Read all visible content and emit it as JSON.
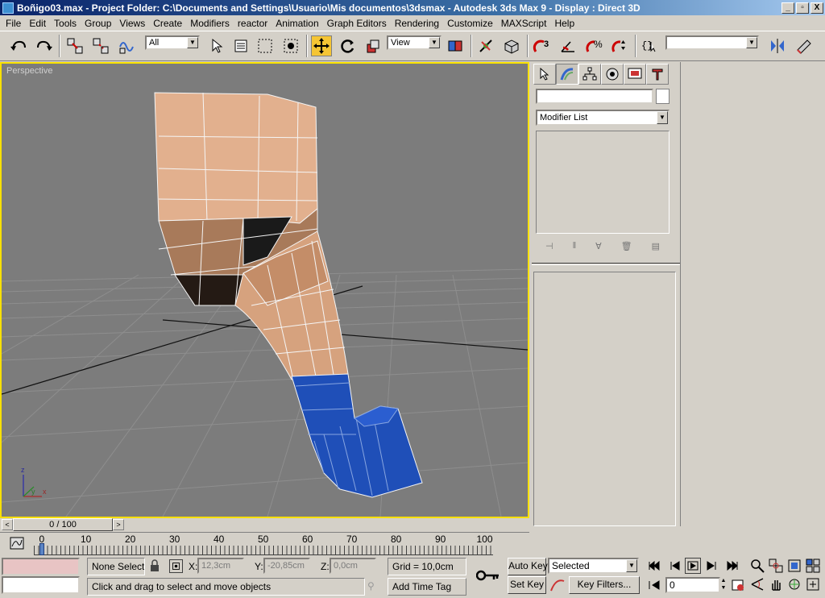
{
  "window": {
    "title": "Boñigo03.max    - Project Folder: C:\\Documents and Settings\\Usuario\\Mis documentos\\3dsmax    - Autodesk 3ds Max 9     - Display : Direct 3D",
    "minimize": "_",
    "maximize": "▫",
    "close": "X"
  },
  "menu": [
    "File",
    "Edit",
    "Tools",
    "Group",
    "Views",
    "Create",
    "Modifiers",
    "reactor",
    "Animation",
    "Graph Editors",
    "Rendering",
    "Customize",
    "MAXScript",
    "Help"
  ],
  "toolbar": {
    "selection_filter": "All",
    "reference_coord": "View",
    "named_selection": "",
    "icons": [
      "undo-icon",
      "redo-icon",
      "select-and-link-icon",
      "unlink-selection-icon",
      "bind-to-space-warp-icon",
      "select-object-icon",
      "select-by-name-icon",
      "rectangular-selection-region-icon",
      "window-crossing-icon",
      "select-and-move-icon",
      "select-and-rotate-icon",
      "select-and-uniform-scale-icon",
      "use-pivot-center-icon",
      "select-and-manipulate-icon",
      "keyboard-shortcut-override-icon",
      "snaps-toggle-icon",
      "angle-snap-icon",
      "percent-snap-icon",
      "spinner-snap-icon",
      "edit-named-selection-icon",
      "mirror-icon",
      "align-icon"
    ]
  },
  "viewport": {
    "label": "Perspective",
    "colors": {
      "background": "#7c7c7c",
      "border_active": "#f8e000",
      "skin": "#e8b08a",
      "shoe": "#1f4fb8"
    },
    "axis": {
      "x": "x",
      "y": "y",
      "z": "z"
    }
  },
  "command_panel": {
    "tabs": [
      "create-tab",
      "modify-tab",
      "hierarchy-tab",
      "motion-tab",
      "display-tab",
      "utilities-tab"
    ],
    "object_name": "",
    "modifier_list": "Modifier List"
  },
  "time_slider": {
    "position": "0 / 100",
    "prev": "<",
    "next": ">",
    "current_frame": 0,
    "total_frames": 100
  },
  "trackbar": {
    "ticks": [
      "0",
      "10",
      "20",
      "30",
      "40",
      "50",
      "60",
      "70",
      "80",
      "90",
      "100"
    ]
  },
  "status": {
    "selection": "None Selecte",
    "x_label": "X:",
    "y_label": "Y:",
    "z_label": "Z:",
    "x_value": "12,3cm",
    "y_value": "-20,85cm",
    "z_value": "0,0cm",
    "grid": "Grid = 10,0cm",
    "prompt": "Click and drag to select and move objects",
    "add_time_tag": "Add Time Tag"
  },
  "animation": {
    "auto_key": "Auto Key",
    "set_key": "Set Key",
    "key_filters": "Key Filters...",
    "selection_set": "Selected",
    "current_frame": "0"
  }
}
